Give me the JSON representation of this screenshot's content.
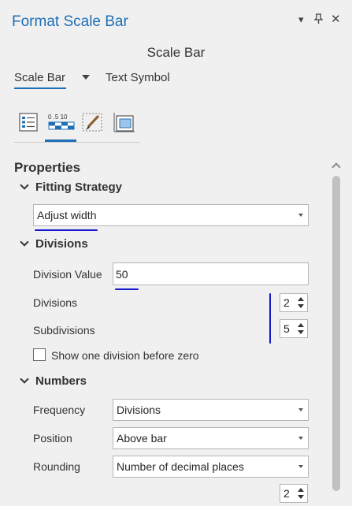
{
  "pane": {
    "title": "Format Scale Bar",
    "menu_icon": "chevron-down-icon",
    "pin_icon": "pin-icon",
    "close_icon": "close-icon"
  },
  "element_name": "Scale Bar",
  "tabs": {
    "active": "Scale Bar",
    "other": "Text Symbol"
  },
  "icon_tabs": [
    "options-icon",
    "scale-bar-properties-icon",
    "display-brush-icon",
    "placement-icon"
  ],
  "section_title": "Properties",
  "fitting_strategy": {
    "header": "Fitting Strategy",
    "value": "Adjust width"
  },
  "divisions_group": {
    "header": "Divisions",
    "division_value_label": "Division Value",
    "division_value": "50",
    "divisions_label": "Divisions",
    "divisions_value": "2",
    "subdivisions_label": "Subdivisions",
    "subdivisions_value": "5",
    "checkbox_label": "Show one division before zero",
    "checkbox_checked": false
  },
  "numbers_group": {
    "header": "Numbers",
    "frequency_label": "Frequency",
    "frequency_value": "Divisions",
    "position_label": "Position",
    "position_value": "Above bar",
    "rounding_label": "Rounding",
    "rounding_value": "Number of decimal places",
    "decimals_value": "2"
  },
  "colors": {
    "accent": "#1f6fb5",
    "annotation": "#1a1acc"
  }
}
